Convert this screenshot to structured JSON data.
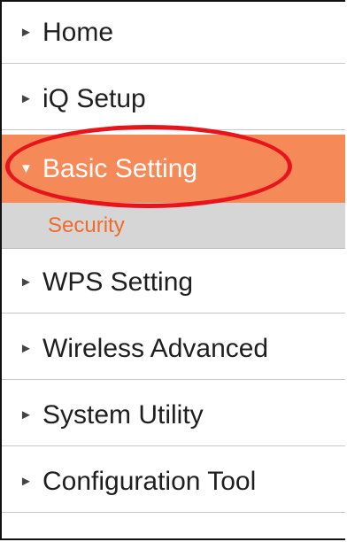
{
  "menu": {
    "items": [
      {
        "label": "Home",
        "arrow": "►"
      },
      {
        "label": "iQ Setup",
        "arrow": "►"
      },
      {
        "label": "Basic Setting",
        "arrow": "▼",
        "active": true
      },
      {
        "label": "WPS Setting",
        "arrow": "►"
      },
      {
        "label": "Wireless Advanced",
        "arrow": "►"
      },
      {
        "label": "System Utility",
        "arrow": "►"
      },
      {
        "label": "Configuration Tool",
        "arrow": "►"
      }
    ],
    "subitems": [
      {
        "label": "Security"
      }
    ]
  },
  "colors": {
    "active_bg": "#f58a58",
    "subitem_bg": "#d6d6d6",
    "subitem_text": "#f06a2b",
    "highlight_ring": "#e8141c"
  },
  "icons": {
    "collapsed": "triangle-right-icon",
    "expanded": "triangle-down-icon"
  }
}
